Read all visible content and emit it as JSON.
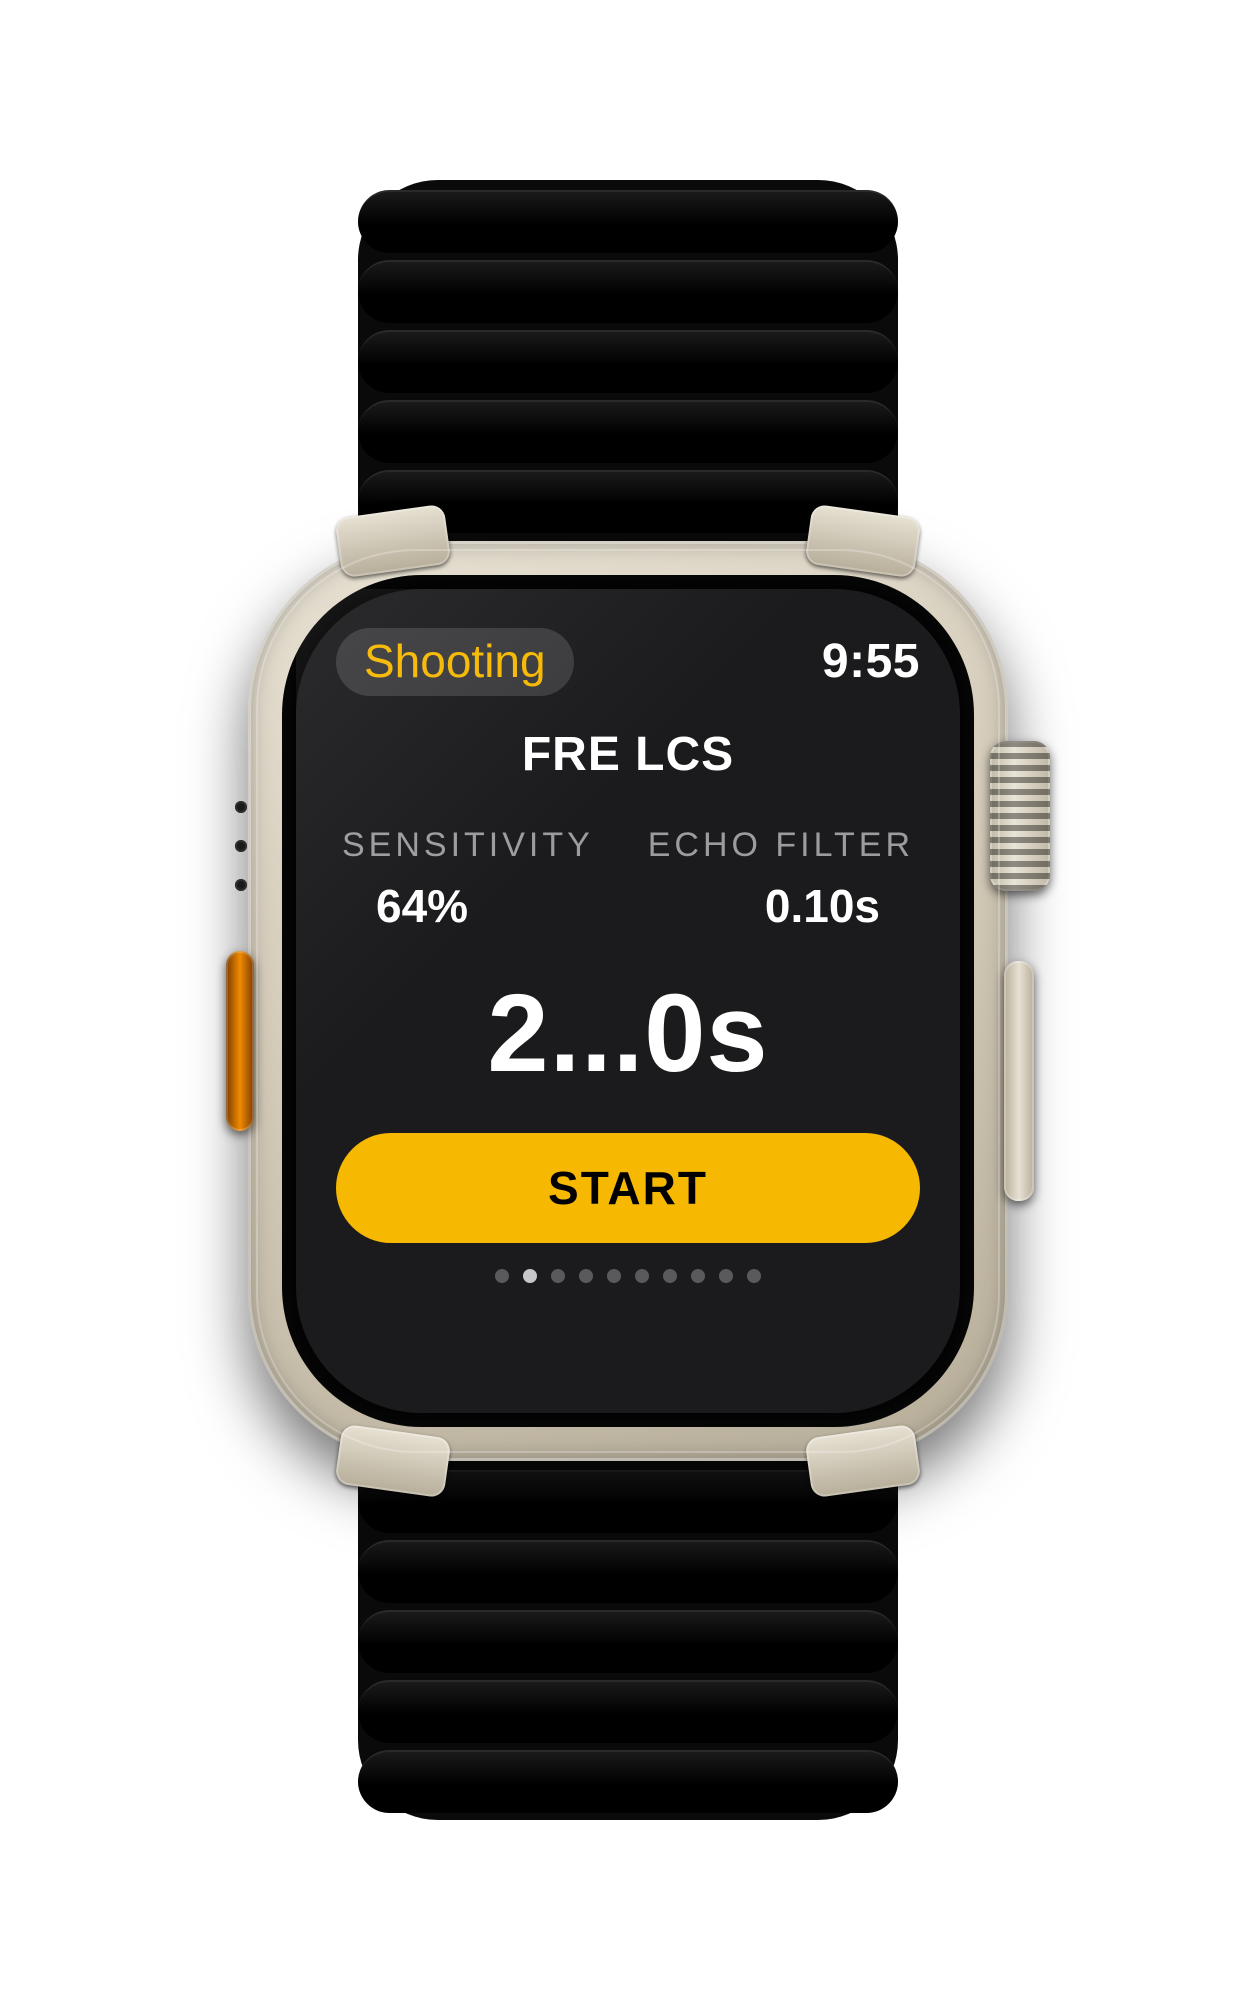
{
  "colors": {
    "accent": "#f6b800"
  },
  "status": {
    "app_label": "Shooting",
    "clock": "9:55"
  },
  "screen": {
    "title": "FRE LCS",
    "labels": {
      "sensitivity": "SENSITIVITY",
      "echo_filter": "ECHO FILTER"
    },
    "values": {
      "sensitivity": "64%",
      "echo_filter": "0.10s"
    },
    "countdown": "2...0s",
    "start_label": "START",
    "page_count": 10,
    "active_page_index": 1
  }
}
